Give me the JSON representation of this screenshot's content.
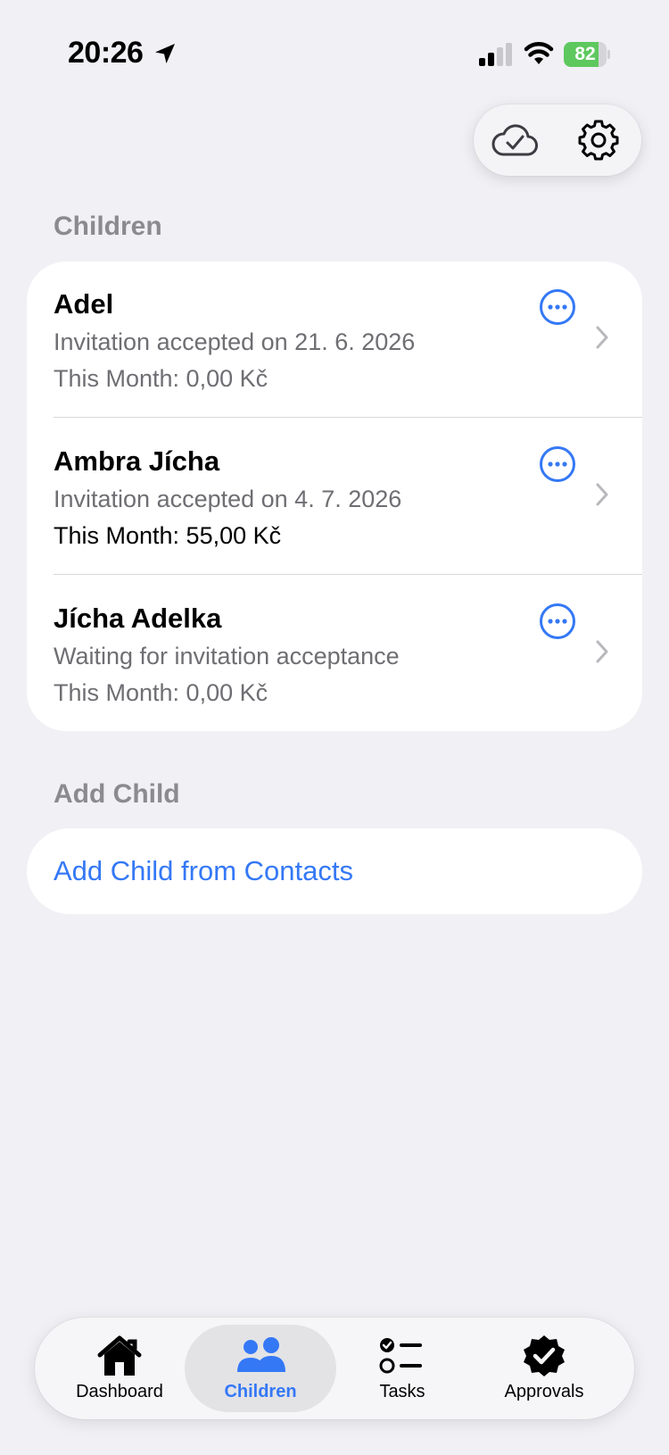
{
  "status_bar": {
    "time": "20:26",
    "battery_percent": "82",
    "battery_level": 0.82
  },
  "top_actions": {
    "sync_icon": "cloud-check-icon",
    "settings_icon": "gear-icon"
  },
  "children_section": {
    "header": "Children",
    "items": [
      {
        "name": "Adel",
        "status": "Invitation accepted on 21. 6. 2026",
        "month": "This Month: 0,00 Kč"
      },
      {
        "name": "Ambra Jícha",
        "status": "Invitation accepted on 4. 7. 2026",
        "month": "This Month: 55,00 Kč"
      },
      {
        "name": "Jícha Adelka",
        "status": "Waiting for invitation acceptance",
        "month": "This Month: 0,00 Kč"
      }
    ]
  },
  "add_section": {
    "header": "Add Child",
    "link": "Add Child from Contacts"
  },
  "tab_bar": {
    "tabs": [
      {
        "label": "Dashboard",
        "icon": "house-icon",
        "active": false
      },
      {
        "label": "Children",
        "icon": "people-icon",
        "active": true
      },
      {
        "label": "Tasks",
        "icon": "checklist-icon",
        "active": false
      },
      {
        "label": "Approvals",
        "icon": "checkmark-seal-icon",
        "active": false
      }
    ]
  },
  "colors": {
    "accent": "#3478f6",
    "background": "#f0f0f5",
    "secondary_text": "#6e6e73",
    "section_header": "#8a8a8f",
    "battery": "#5dc85e"
  }
}
